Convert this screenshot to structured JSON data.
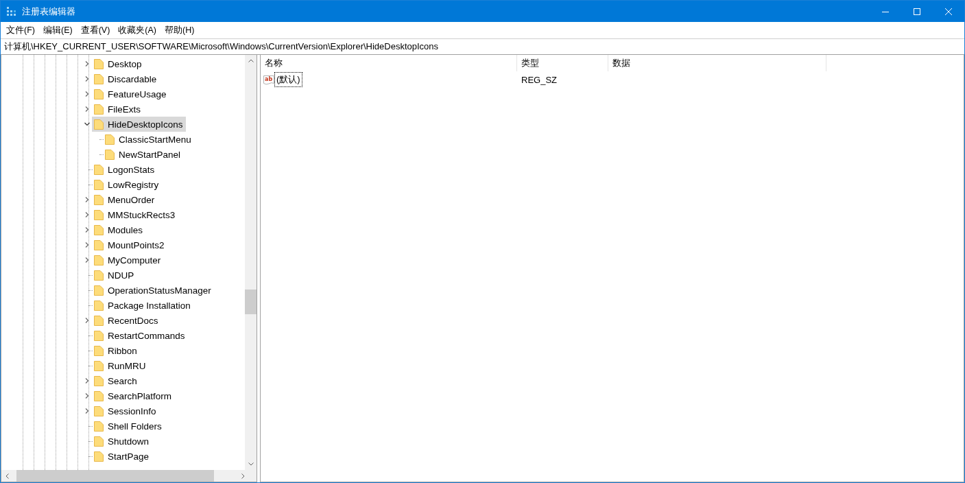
{
  "window": {
    "title": "注册表编辑器"
  },
  "menu": [
    "文件(F)",
    "编辑(E)",
    "查看(V)",
    "收藏夹(A)",
    "帮助(H)"
  ],
  "address": "计算机\\HKEY_CURRENT_USER\\SOFTWARE\\Microsoft\\Windows\\CurrentVersion\\Explorer\\HideDesktopIcons",
  "tree": {
    "items": [
      {
        "label": "Desktop",
        "expanded": false,
        "selected": false
      },
      {
        "label": "Discardable",
        "expanded": false,
        "selected": false
      },
      {
        "label": "FeatureUsage",
        "expanded": false,
        "selected": false
      },
      {
        "label": "FileExts",
        "expanded": false,
        "selected": false
      },
      {
        "label": "HideDesktopIcons",
        "expanded": true,
        "selected": true,
        "children": [
          {
            "label": "ClassicStartMenu",
            "selected": false
          },
          {
            "label": "NewStartPanel",
            "selected": false
          }
        ]
      },
      {
        "label": "LogonStats",
        "selected": false
      },
      {
        "label": "LowRegistry",
        "selected": false
      },
      {
        "label": "MenuOrder",
        "expanded": false,
        "selected": false
      },
      {
        "label": "MMStuckRects3",
        "expanded": false,
        "selected": false
      },
      {
        "label": "Modules",
        "expanded": false,
        "selected": false
      },
      {
        "label": "MountPoints2",
        "expanded": false,
        "selected": false
      },
      {
        "label": "MyComputer",
        "expanded": false,
        "selected": false
      },
      {
        "label": "NDUP",
        "selected": false
      },
      {
        "label": "OperationStatusManager",
        "selected": false
      },
      {
        "label": "Package Installation",
        "selected": false
      },
      {
        "label": "RecentDocs",
        "expanded": false,
        "selected": false
      },
      {
        "label": "RestartCommands",
        "selected": false
      },
      {
        "label": "Ribbon",
        "selected": false
      },
      {
        "label": "RunMRU",
        "selected": false
      },
      {
        "label": "Search",
        "expanded": false,
        "selected": false
      },
      {
        "label": "SearchPlatform",
        "expanded": false,
        "selected": false
      },
      {
        "label": "SessionInfo",
        "expanded": false,
        "selected": false
      },
      {
        "label": "Shell Folders",
        "selected": false
      },
      {
        "label": "Shutdown",
        "selected": false
      },
      {
        "label": "StartPage",
        "selected": false
      }
    ]
  },
  "table": {
    "columns": [
      "名称",
      "类型",
      "数据"
    ],
    "rows": [
      {
        "icon_text": "ab",
        "name": "(默认)",
        "type": "REG_SZ",
        "focused": true
      }
    ]
  }
}
